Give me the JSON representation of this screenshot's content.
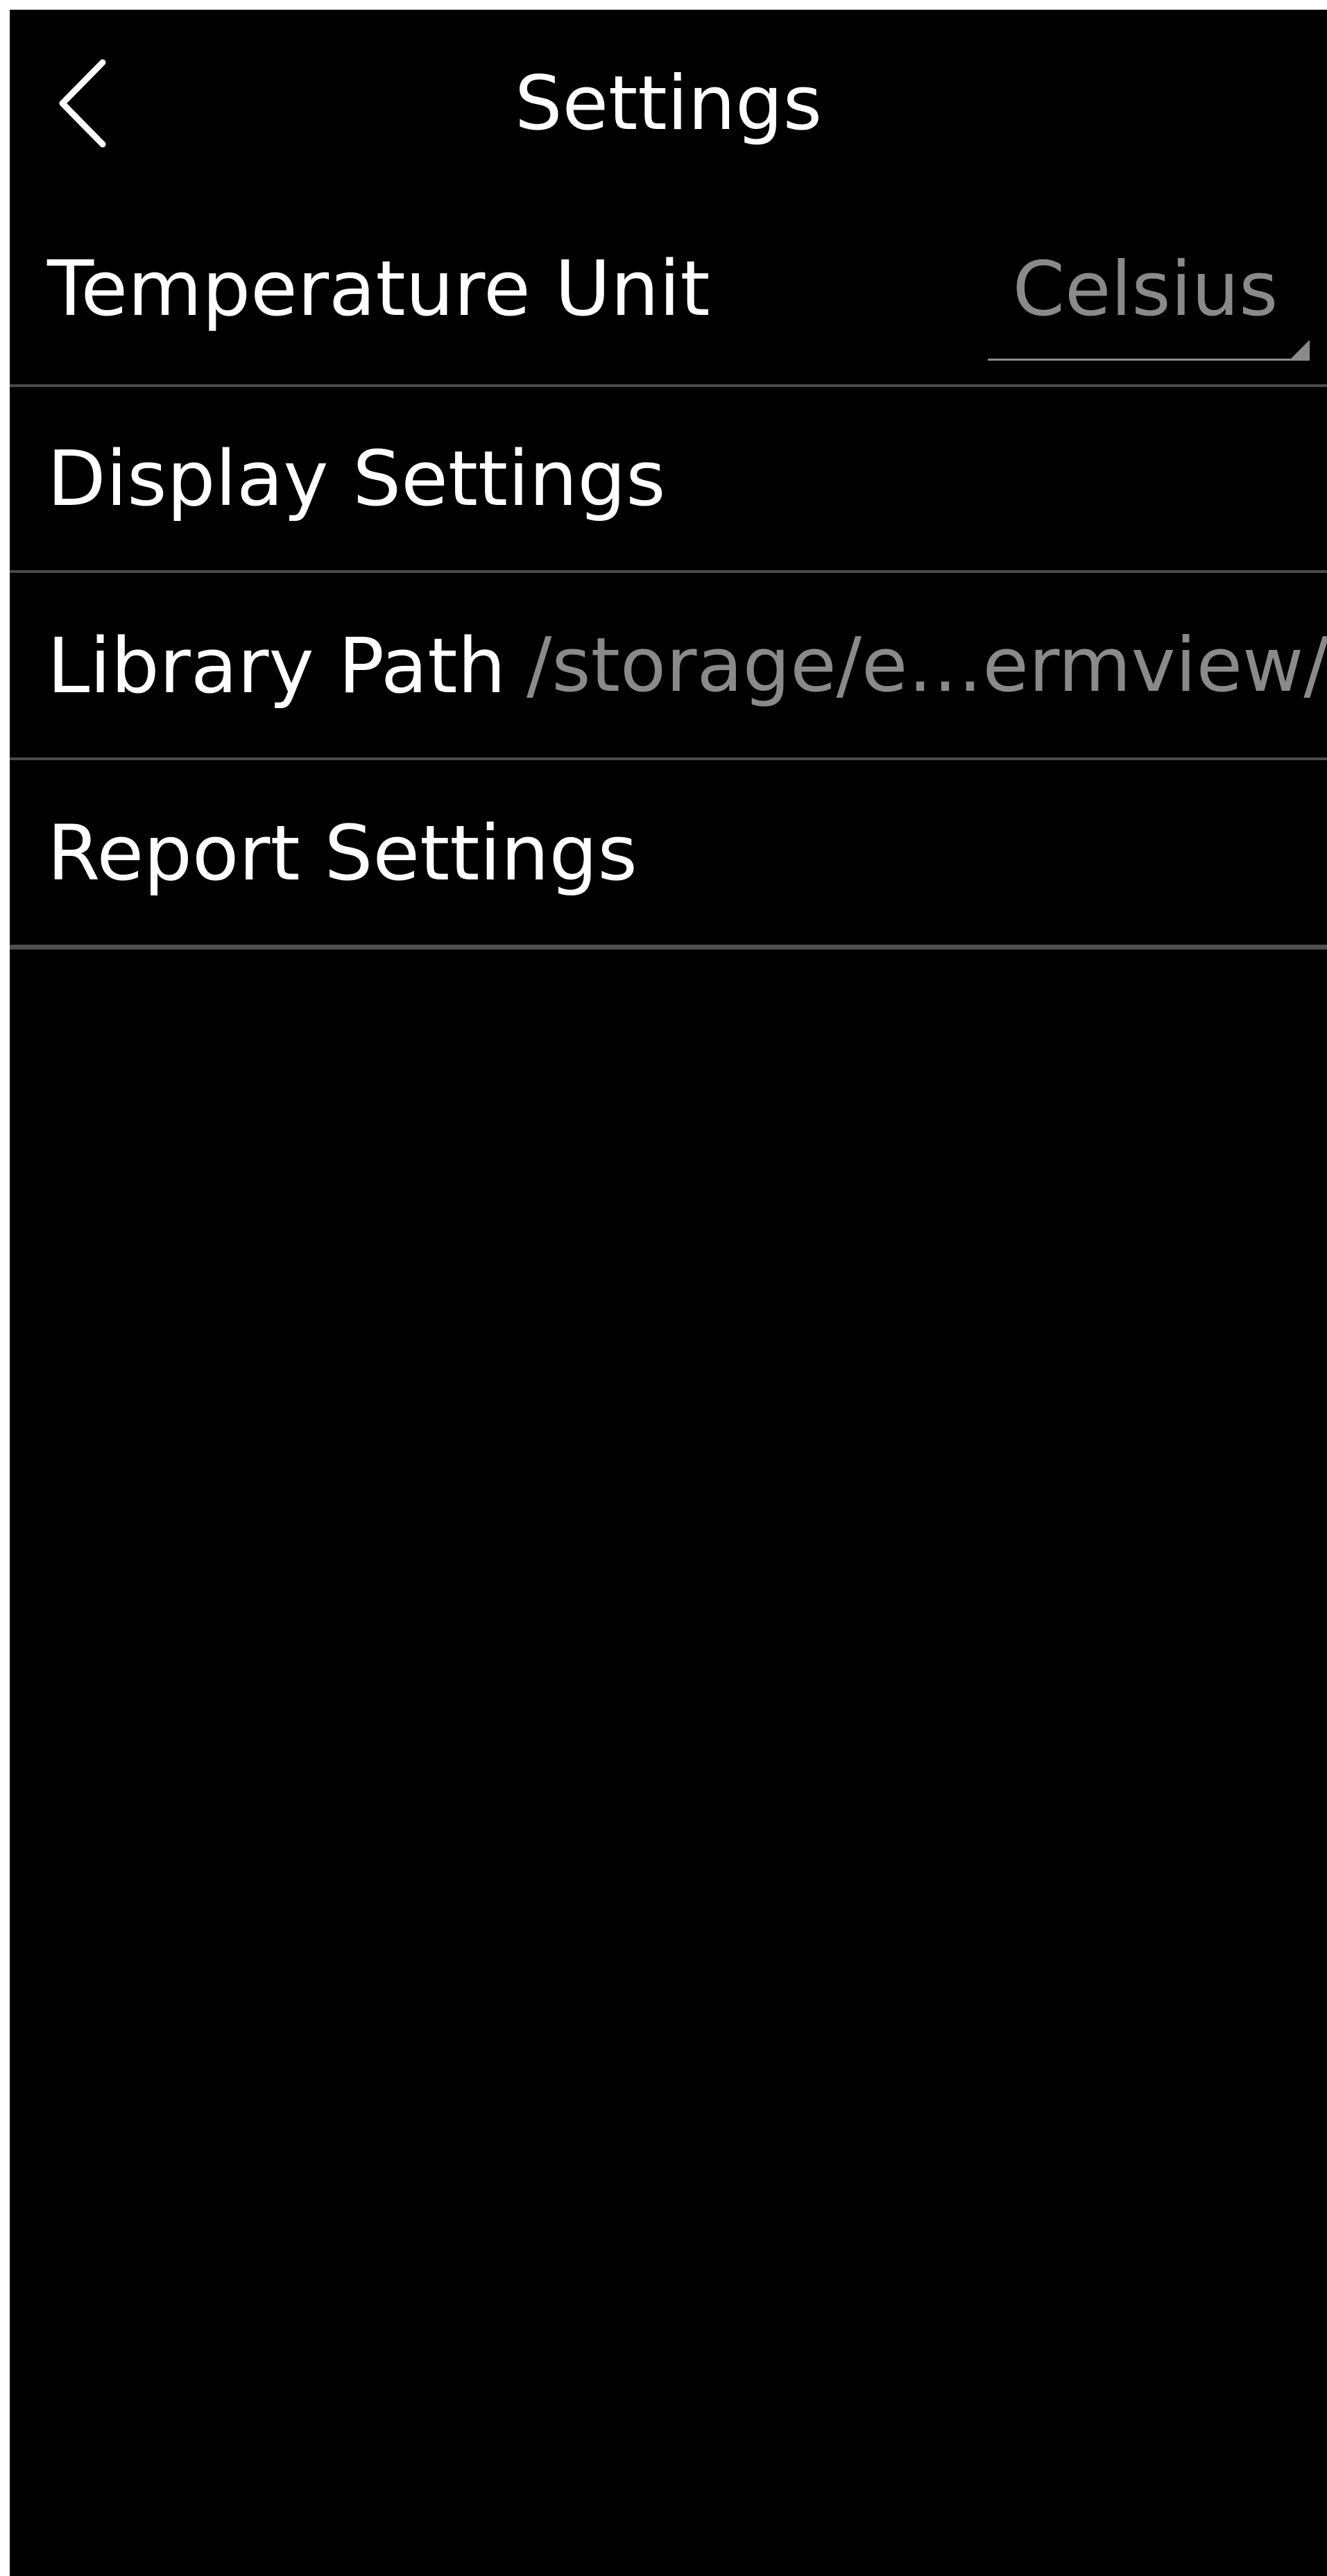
{
  "header": {
    "title": "Settings",
    "back_icon": "chevron-left-icon"
  },
  "settings": {
    "temperature_unit": {
      "label": "Temperature Unit",
      "value": "Celsius"
    },
    "display_settings": {
      "label": "Display Settings"
    },
    "library_path": {
      "label": "Library Path",
      "value": "/storage/e…ermview/"
    },
    "report_settings": {
      "label": "Report Settings"
    }
  },
  "colors": {
    "background": "#000000",
    "text_primary": "#ffffff",
    "text_secondary": "#8a8a8a",
    "divider": "#4a4a4a"
  }
}
